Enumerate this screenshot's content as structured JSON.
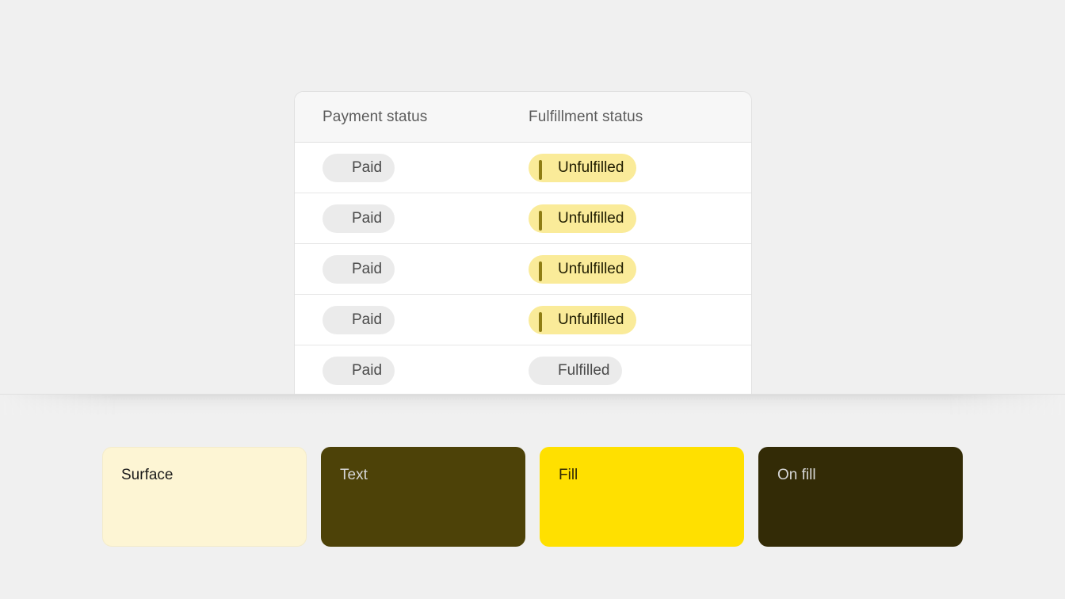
{
  "page": {
    "background_color": "#F0F0F0"
  },
  "table": {
    "columns": [
      {
        "key": "payment_status",
        "label": "Payment status"
      },
      {
        "key": "fulfillment_status",
        "label": "Fulfillment status"
      }
    ],
    "rows": [
      {
        "payment_status": {
          "label": "Paid",
          "icon": "filled-circle-icon",
          "tone": "default"
        },
        "fulfillment_status": {
          "label": "Unfulfilled",
          "icon": "hollow-ring-icon",
          "tone": "warning"
        }
      },
      {
        "payment_status": {
          "label": "Paid",
          "icon": "filled-circle-icon",
          "tone": "default"
        },
        "fulfillment_status": {
          "label": "Unfulfilled",
          "icon": "hollow-ring-icon",
          "tone": "warning"
        }
      },
      {
        "payment_status": {
          "label": "Paid",
          "icon": "filled-circle-icon",
          "tone": "default"
        },
        "fulfillment_status": {
          "label": "Unfulfilled",
          "icon": "hollow-ring-icon",
          "tone": "warning"
        }
      },
      {
        "payment_status": {
          "label": "Paid",
          "icon": "filled-circle-icon",
          "tone": "default"
        },
        "fulfillment_status": {
          "label": "Unfulfilled",
          "icon": "hollow-ring-icon",
          "tone": "warning"
        }
      },
      {
        "payment_status": {
          "label": "Paid",
          "icon": "filled-circle-icon",
          "tone": "default"
        },
        "fulfillment_status": {
          "label": "Fulfilled",
          "icon": "filled-circle-icon",
          "tone": "default"
        }
      }
    ],
    "badge_colors": {
      "default_background": "#EBEBEB",
      "default_text": "#4A4A4A",
      "default_icon": "#8A8A8A",
      "warning_background": "#FAEB99",
      "warning_text": "#1F1C00",
      "warning_icon": "#8F7D14"
    }
  },
  "swatches": [
    {
      "label": "Surface",
      "background": "#FDF5D4",
      "text_color": "#1A1A1A",
      "border": "#F3EBCB"
    },
    {
      "label": "Text",
      "background": "#4D4208",
      "text_color": "#D6D6D6",
      "border": "transparent"
    },
    {
      "label": "Fill",
      "background": "#FFE000",
      "text_color": "#332B06",
      "border": "transparent"
    },
    {
      "label": "On fill",
      "background": "#332B06",
      "text_color": "#D6D6D6",
      "border": "transparent"
    }
  ]
}
